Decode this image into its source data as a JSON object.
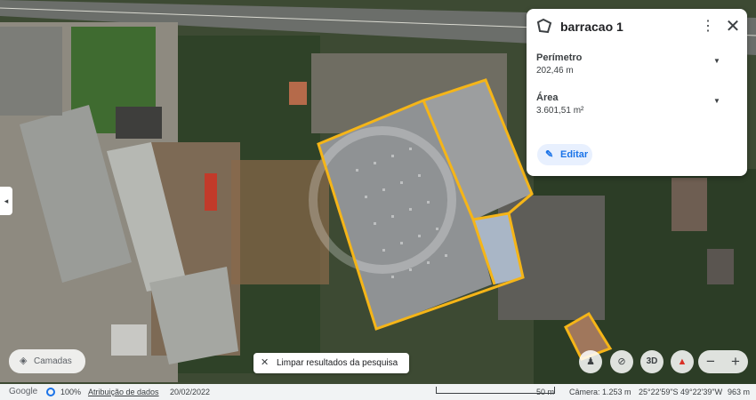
{
  "panel": {
    "title": "barracao 1",
    "icon": "polygon-icon",
    "menu_icon": "⋮",
    "close_icon": "✕",
    "rows": [
      {
        "label": "Perímetro",
        "value": "202,46 m"
      },
      {
        "label": "Área",
        "value": "3.601,51 m²"
      }
    ],
    "edit_label": "Editar"
  },
  "left_tab": {
    "icon": "◂"
  },
  "layers": {
    "label": "Camadas",
    "icon": "layers-icon"
  },
  "clear_search": {
    "label": "Limpar resultados da pesquisa",
    "icon": "✕"
  },
  "controls": {
    "threed_label": "3D",
    "zoom_out": "−",
    "zoom_in": "+"
  },
  "bottom_bar": {
    "logo": "Google",
    "quality": "100%",
    "attribution": "Atribuição de dados",
    "date": "20/02/2022",
    "scale": "50 m",
    "camera": "Câmera: 1.253 m",
    "coords": "25°22'59\"S 49°22'39\"W",
    "elevation": "963 m"
  },
  "colors": {
    "outline": "#f5b518",
    "accent": "#1a73e8"
  }
}
